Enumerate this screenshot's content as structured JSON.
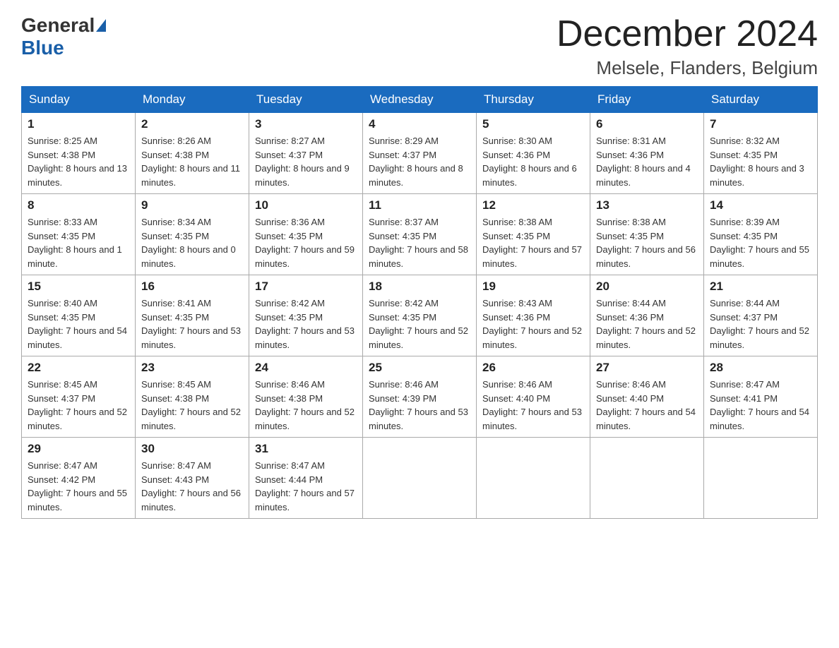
{
  "header": {
    "logo_general": "General",
    "logo_blue": "Blue",
    "month": "December 2024",
    "location": "Melsele, Flanders, Belgium"
  },
  "weekdays": [
    "Sunday",
    "Monday",
    "Tuesday",
    "Wednesday",
    "Thursday",
    "Friday",
    "Saturday"
  ],
  "weeks": [
    [
      {
        "day": "1",
        "sunrise": "8:25 AM",
        "sunset": "4:38 PM",
        "daylight": "8 hours and 13 minutes."
      },
      {
        "day": "2",
        "sunrise": "8:26 AM",
        "sunset": "4:38 PM",
        "daylight": "8 hours and 11 minutes."
      },
      {
        "day": "3",
        "sunrise": "8:27 AM",
        "sunset": "4:37 PM",
        "daylight": "8 hours and 9 minutes."
      },
      {
        "day": "4",
        "sunrise": "8:29 AM",
        "sunset": "4:37 PM",
        "daylight": "8 hours and 8 minutes."
      },
      {
        "day": "5",
        "sunrise": "8:30 AM",
        "sunset": "4:36 PM",
        "daylight": "8 hours and 6 minutes."
      },
      {
        "day": "6",
        "sunrise": "8:31 AM",
        "sunset": "4:36 PM",
        "daylight": "8 hours and 4 minutes."
      },
      {
        "day": "7",
        "sunrise": "8:32 AM",
        "sunset": "4:35 PM",
        "daylight": "8 hours and 3 minutes."
      }
    ],
    [
      {
        "day": "8",
        "sunrise": "8:33 AM",
        "sunset": "4:35 PM",
        "daylight": "8 hours and 1 minute."
      },
      {
        "day": "9",
        "sunrise": "8:34 AM",
        "sunset": "4:35 PM",
        "daylight": "8 hours and 0 minutes."
      },
      {
        "day": "10",
        "sunrise": "8:36 AM",
        "sunset": "4:35 PM",
        "daylight": "7 hours and 59 minutes."
      },
      {
        "day": "11",
        "sunrise": "8:37 AM",
        "sunset": "4:35 PM",
        "daylight": "7 hours and 58 minutes."
      },
      {
        "day": "12",
        "sunrise": "8:38 AM",
        "sunset": "4:35 PM",
        "daylight": "7 hours and 57 minutes."
      },
      {
        "day": "13",
        "sunrise": "8:38 AM",
        "sunset": "4:35 PM",
        "daylight": "7 hours and 56 minutes."
      },
      {
        "day": "14",
        "sunrise": "8:39 AM",
        "sunset": "4:35 PM",
        "daylight": "7 hours and 55 minutes."
      }
    ],
    [
      {
        "day": "15",
        "sunrise": "8:40 AM",
        "sunset": "4:35 PM",
        "daylight": "7 hours and 54 minutes."
      },
      {
        "day": "16",
        "sunrise": "8:41 AM",
        "sunset": "4:35 PM",
        "daylight": "7 hours and 53 minutes."
      },
      {
        "day": "17",
        "sunrise": "8:42 AM",
        "sunset": "4:35 PM",
        "daylight": "7 hours and 53 minutes."
      },
      {
        "day": "18",
        "sunrise": "8:42 AM",
        "sunset": "4:35 PM",
        "daylight": "7 hours and 52 minutes."
      },
      {
        "day": "19",
        "sunrise": "8:43 AM",
        "sunset": "4:36 PM",
        "daylight": "7 hours and 52 minutes."
      },
      {
        "day": "20",
        "sunrise": "8:44 AM",
        "sunset": "4:36 PM",
        "daylight": "7 hours and 52 minutes."
      },
      {
        "day": "21",
        "sunrise": "8:44 AM",
        "sunset": "4:37 PM",
        "daylight": "7 hours and 52 minutes."
      }
    ],
    [
      {
        "day": "22",
        "sunrise": "8:45 AM",
        "sunset": "4:37 PM",
        "daylight": "7 hours and 52 minutes."
      },
      {
        "day": "23",
        "sunrise": "8:45 AM",
        "sunset": "4:38 PM",
        "daylight": "7 hours and 52 minutes."
      },
      {
        "day": "24",
        "sunrise": "8:46 AM",
        "sunset": "4:38 PM",
        "daylight": "7 hours and 52 minutes."
      },
      {
        "day": "25",
        "sunrise": "8:46 AM",
        "sunset": "4:39 PM",
        "daylight": "7 hours and 53 minutes."
      },
      {
        "day": "26",
        "sunrise": "8:46 AM",
        "sunset": "4:40 PM",
        "daylight": "7 hours and 53 minutes."
      },
      {
        "day": "27",
        "sunrise": "8:46 AM",
        "sunset": "4:40 PM",
        "daylight": "7 hours and 54 minutes."
      },
      {
        "day": "28",
        "sunrise": "8:47 AM",
        "sunset": "4:41 PM",
        "daylight": "7 hours and 54 minutes."
      }
    ],
    [
      {
        "day": "29",
        "sunrise": "8:47 AM",
        "sunset": "4:42 PM",
        "daylight": "7 hours and 55 minutes."
      },
      {
        "day": "30",
        "sunrise": "8:47 AM",
        "sunset": "4:43 PM",
        "daylight": "7 hours and 56 minutes."
      },
      {
        "day": "31",
        "sunrise": "8:47 AM",
        "sunset": "4:44 PM",
        "daylight": "7 hours and 57 minutes."
      },
      null,
      null,
      null,
      null
    ]
  ]
}
